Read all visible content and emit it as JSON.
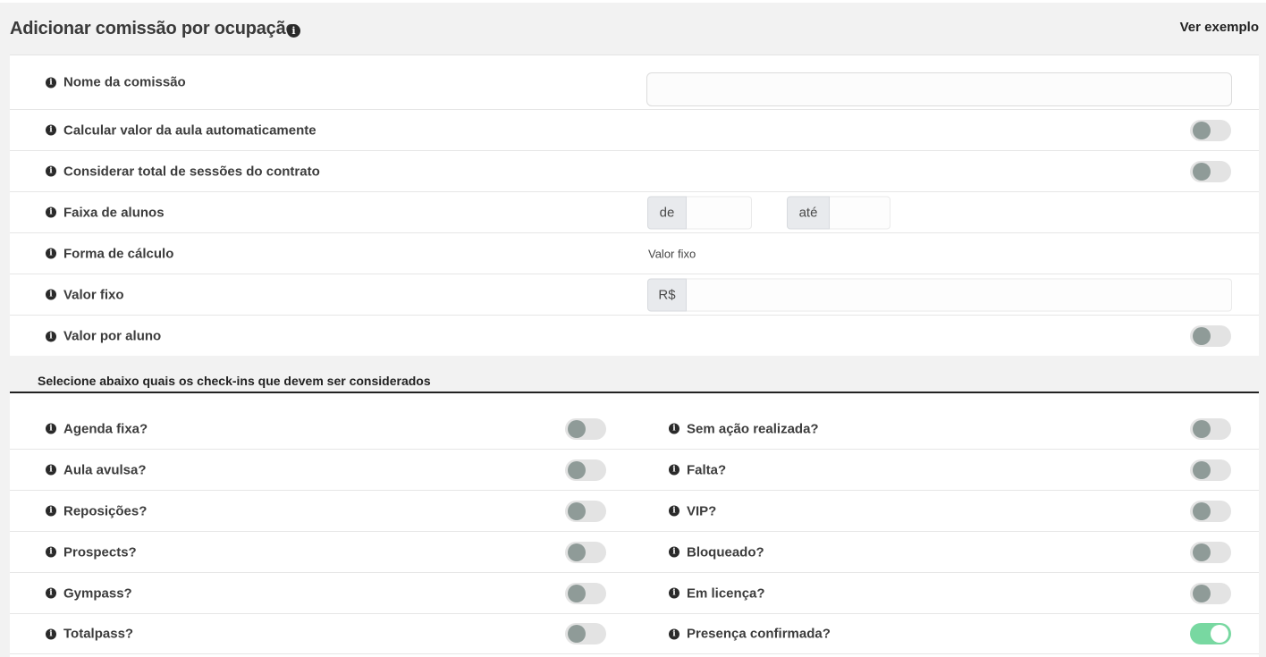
{
  "header": {
    "title": "Adicionar comissão por ocupação",
    "example_link": "Ver exemplo"
  },
  "form": {
    "nome": {
      "label": "Nome da comissão",
      "value": "",
      "placeholder": ""
    },
    "calcular": {
      "label": "Calcular valor da aula automaticamente",
      "enabled": false
    },
    "considerar": {
      "label": "Considerar total de sessões do contrato",
      "enabled": false
    },
    "faixa": {
      "label": "Faixa de alunos",
      "from_addon": "de",
      "to_addon": "até",
      "from_value": "",
      "to_value": ""
    },
    "forma": {
      "label": "Forma de cálculo",
      "value": "Valor fixo"
    },
    "valor_fixo": {
      "label": "Valor fixo",
      "currency": "R$",
      "value": ""
    },
    "valor_por_aluno": {
      "label": "Valor por aluno",
      "enabled": false
    }
  },
  "checkins": {
    "title": "Selecione abaixo quais os check-ins que devem ser considerados",
    "left": [
      {
        "label": "Agenda fixa?",
        "enabled": false
      },
      {
        "label": "Aula avulsa?",
        "enabled": false
      },
      {
        "label": "Reposições?",
        "enabled": false
      },
      {
        "label": "Prospects?",
        "enabled": false
      },
      {
        "label": "Gympass?",
        "enabled": false
      },
      {
        "label": "Totalpass?",
        "enabled": false
      }
    ],
    "right": [
      {
        "label": "Sem ação realizada?",
        "enabled": false
      },
      {
        "label": "Falta?",
        "enabled": false
      },
      {
        "label": "VIP?",
        "enabled": false
      },
      {
        "label": "Bloqueado?",
        "enabled": false
      },
      {
        "label": "Em licença?",
        "enabled": false
      },
      {
        "label": "Presença confirmada?",
        "enabled": true
      }
    ]
  },
  "colors": {
    "toggle_on": "#78d8a1",
    "toggle_off_track": "#e3e3e3",
    "toggle_off_knob": "#8f9b98"
  }
}
